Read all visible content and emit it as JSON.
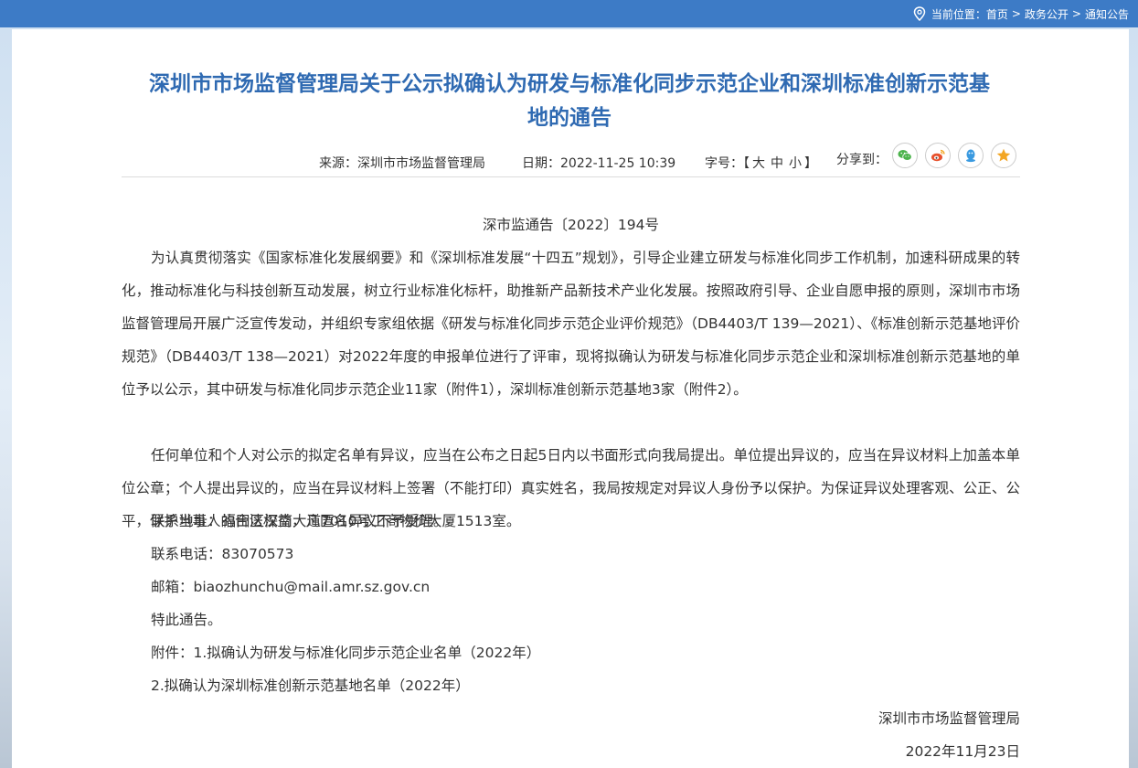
{
  "breadcrumb": {
    "prefix": "当前位置：",
    "items": [
      "首页",
      "政务公开",
      "通知公告"
    ],
    "separator": ">"
  },
  "article": {
    "title_line1": "深圳市市场监督管理局关于公示拟确认为研发与标准化同步示范企业和深圳标准创新示范基",
    "title_line2": "地的通告",
    "source": "来源：深圳市市场监督管理局",
    "date": "日期：2022-11-25 10:39",
    "font_size_label": "字号：",
    "font_size_open": "【",
    "font_size_options": [
      "大",
      "中",
      "小"
    ],
    "font_size_close": "】",
    "share_label": "分享到：",
    "doc_number": "深市监通告〔2022〕194号",
    "paragraph1": "为认真贯彻落实《国家标准化发展纲要》和《深圳标准发展“十四五”规划》，引导企业建立研发与标准化同步工作机制，加速科研成果的转化，推动标准化与科技创新互动发展，树立行业标准化标杆，助推新产品新技术产业化发展。按照政府引导、企业自愿申报的原则，深圳市市场监督管理局开展广泛宣传发动，并组织专家组依据《研发与标准化同步示范企业评价规范》（DB4403/T 139—2021）、《标准创新示范基地评价规范》（DB4403/T 138—2021）对2022年度的申报单位进行了评审，现将拟确认为研发与标准化同步示范企业和深圳标准创新示范基地的单位予以公示，其中研发与标准化同步示范企业11家（附件1），深圳标准创新示范基地3家（附件2）。",
    "paragraph2": "任何单位和个人对公示的拟定名单有异议，应当在公布之日起5日内以书面形式向我局提出。单位提出异议的，应当在异议材料上加盖本单位公章；个人提出异议的，应当在异议材料上签署（不能打印）真实姓名，我局按规定对异议人身份予以保护。为保证异议处理客观、公正、公平，保护当事人的合法权益，凡匿名异议不予受理。",
    "address": "联系地址：福田区深南大道7010号工商物价大厦1513室。",
    "phone": "联系电话：83070573",
    "email": "邮箱：biaozhunchu@mail.amr.sz.gov.cn",
    "closing": "特此通告。",
    "attachment1": "附件：1.拟确认为研发与标准化同步示范企业名单（2022年）",
    "attachment2": "2.拟确认为深圳标准创新示范基地名单（2022年）",
    "signature": "深圳市市场监督管理局",
    "sign_date": "2022年11月23日"
  },
  "share_icons": [
    {
      "name": "wechat-icon",
      "color": "#4bb34b"
    },
    {
      "name": "weibo-icon",
      "color": "#e8522e"
    },
    {
      "name": "qq-icon",
      "color": "#3a9ae0"
    },
    {
      "name": "favorite-icon",
      "color": "#f3a623"
    }
  ],
  "colors": {
    "topbar": "#3d7bc6",
    "title": "#2f6ab2",
    "text": "#333333"
  }
}
